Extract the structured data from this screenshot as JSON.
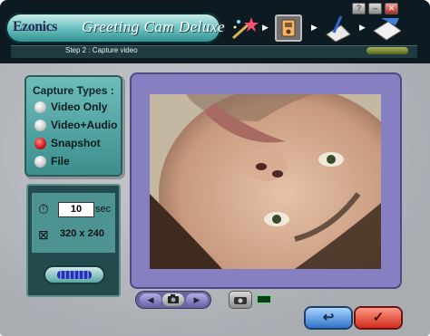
{
  "window": {
    "logo": "Ezonics",
    "title": "Greeting Cam Deluxe",
    "controls": [
      "?",
      "–",
      "✕"
    ]
  },
  "steps": {
    "current_label": "Step 2 : Capture video",
    "icons": [
      "wizard-wand-icon",
      "camera-step-icon",
      "edit-card-icon",
      "send-mail-icon"
    ]
  },
  "capture_types": {
    "title": "Capture Types :",
    "options": [
      {
        "label": "Video Only",
        "selected": false
      },
      {
        "label": "Video+Audio",
        "selected": false
      },
      {
        "label": "Snapshot",
        "selected": true
      },
      {
        "label": "File",
        "selected": false
      }
    ]
  },
  "settings": {
    "timer_value": "10",
    "timer_unit": "sec",
    "resolution": "320 x 240"
  },
  "video_controls": {
    "prev": "◀",
    "camera": "📷",
    "next": "▶",
    "snapshot_icon": "camera-snap-icon"
  },
  "footer": {
    "back_symbol": "↩",
    "ok_symbol": "✓"
  },
  "colors": {
    "header_bg": "#0d1a22",
    "panel_teal": "#4d9391",
    "video_frame": "#8680c2",
    "back_blue": "#2f73c7",
    "ok_red": "#d02c1e"
  }
}
